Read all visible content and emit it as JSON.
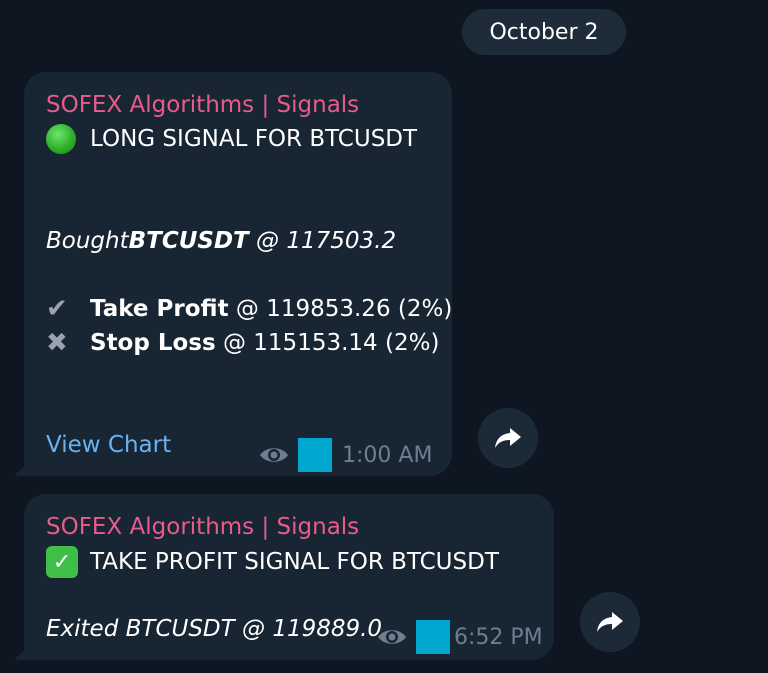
{
  "date_label": "October 2",
  "messages": [
    {
      "sender": "SOFEX Algorithms | Signals",
      "headline": "LONG SIGNAL FOR BTCUSDT",
      "bought_prefix": "Bought ",
      "bought_symbol": "BTCUSDT",
      "bought_suffix": " @ 117503.2",
      "take_profit_label": "Take Profit",
      "take_profit_value": " @ 119853.26 (2%)",
      "stop_loss_label": "Stop Loss",
      "stop_loss_value": " @ 115153.14 (2%)",
      "link_label": "View Chart",
      "time": "1:00 AM"
    },
    {
      "sender": "SOFEX Algorithms | Signals",
      "headline": "TAKE PROFIT SIGNAL FOR BTCUSDT",
      "exited_text": "Exited BTCUSDT @ 119889.0",
      "time": "6:52 PM"
    }
  ],
  "icons": {
    "status_green": "green-circle-icon",
    "check_emoji": "check-mark-button-icon",
    "take_profit": "heavy-check-icon",
    "stop_loss": "heavy-x-icon",
    "views": "eye-icon",
    "forward": "forward-arrow-icon"
  },
  "colors": {
    "background": "#0e1621",
    "bubble": "#182533",
    "sender": "#e85c8b",
    "link": "#6ab2f2",
    "meta": "#6d7f8f",
    "reaction_block": "#00a8d0"
  }
}
